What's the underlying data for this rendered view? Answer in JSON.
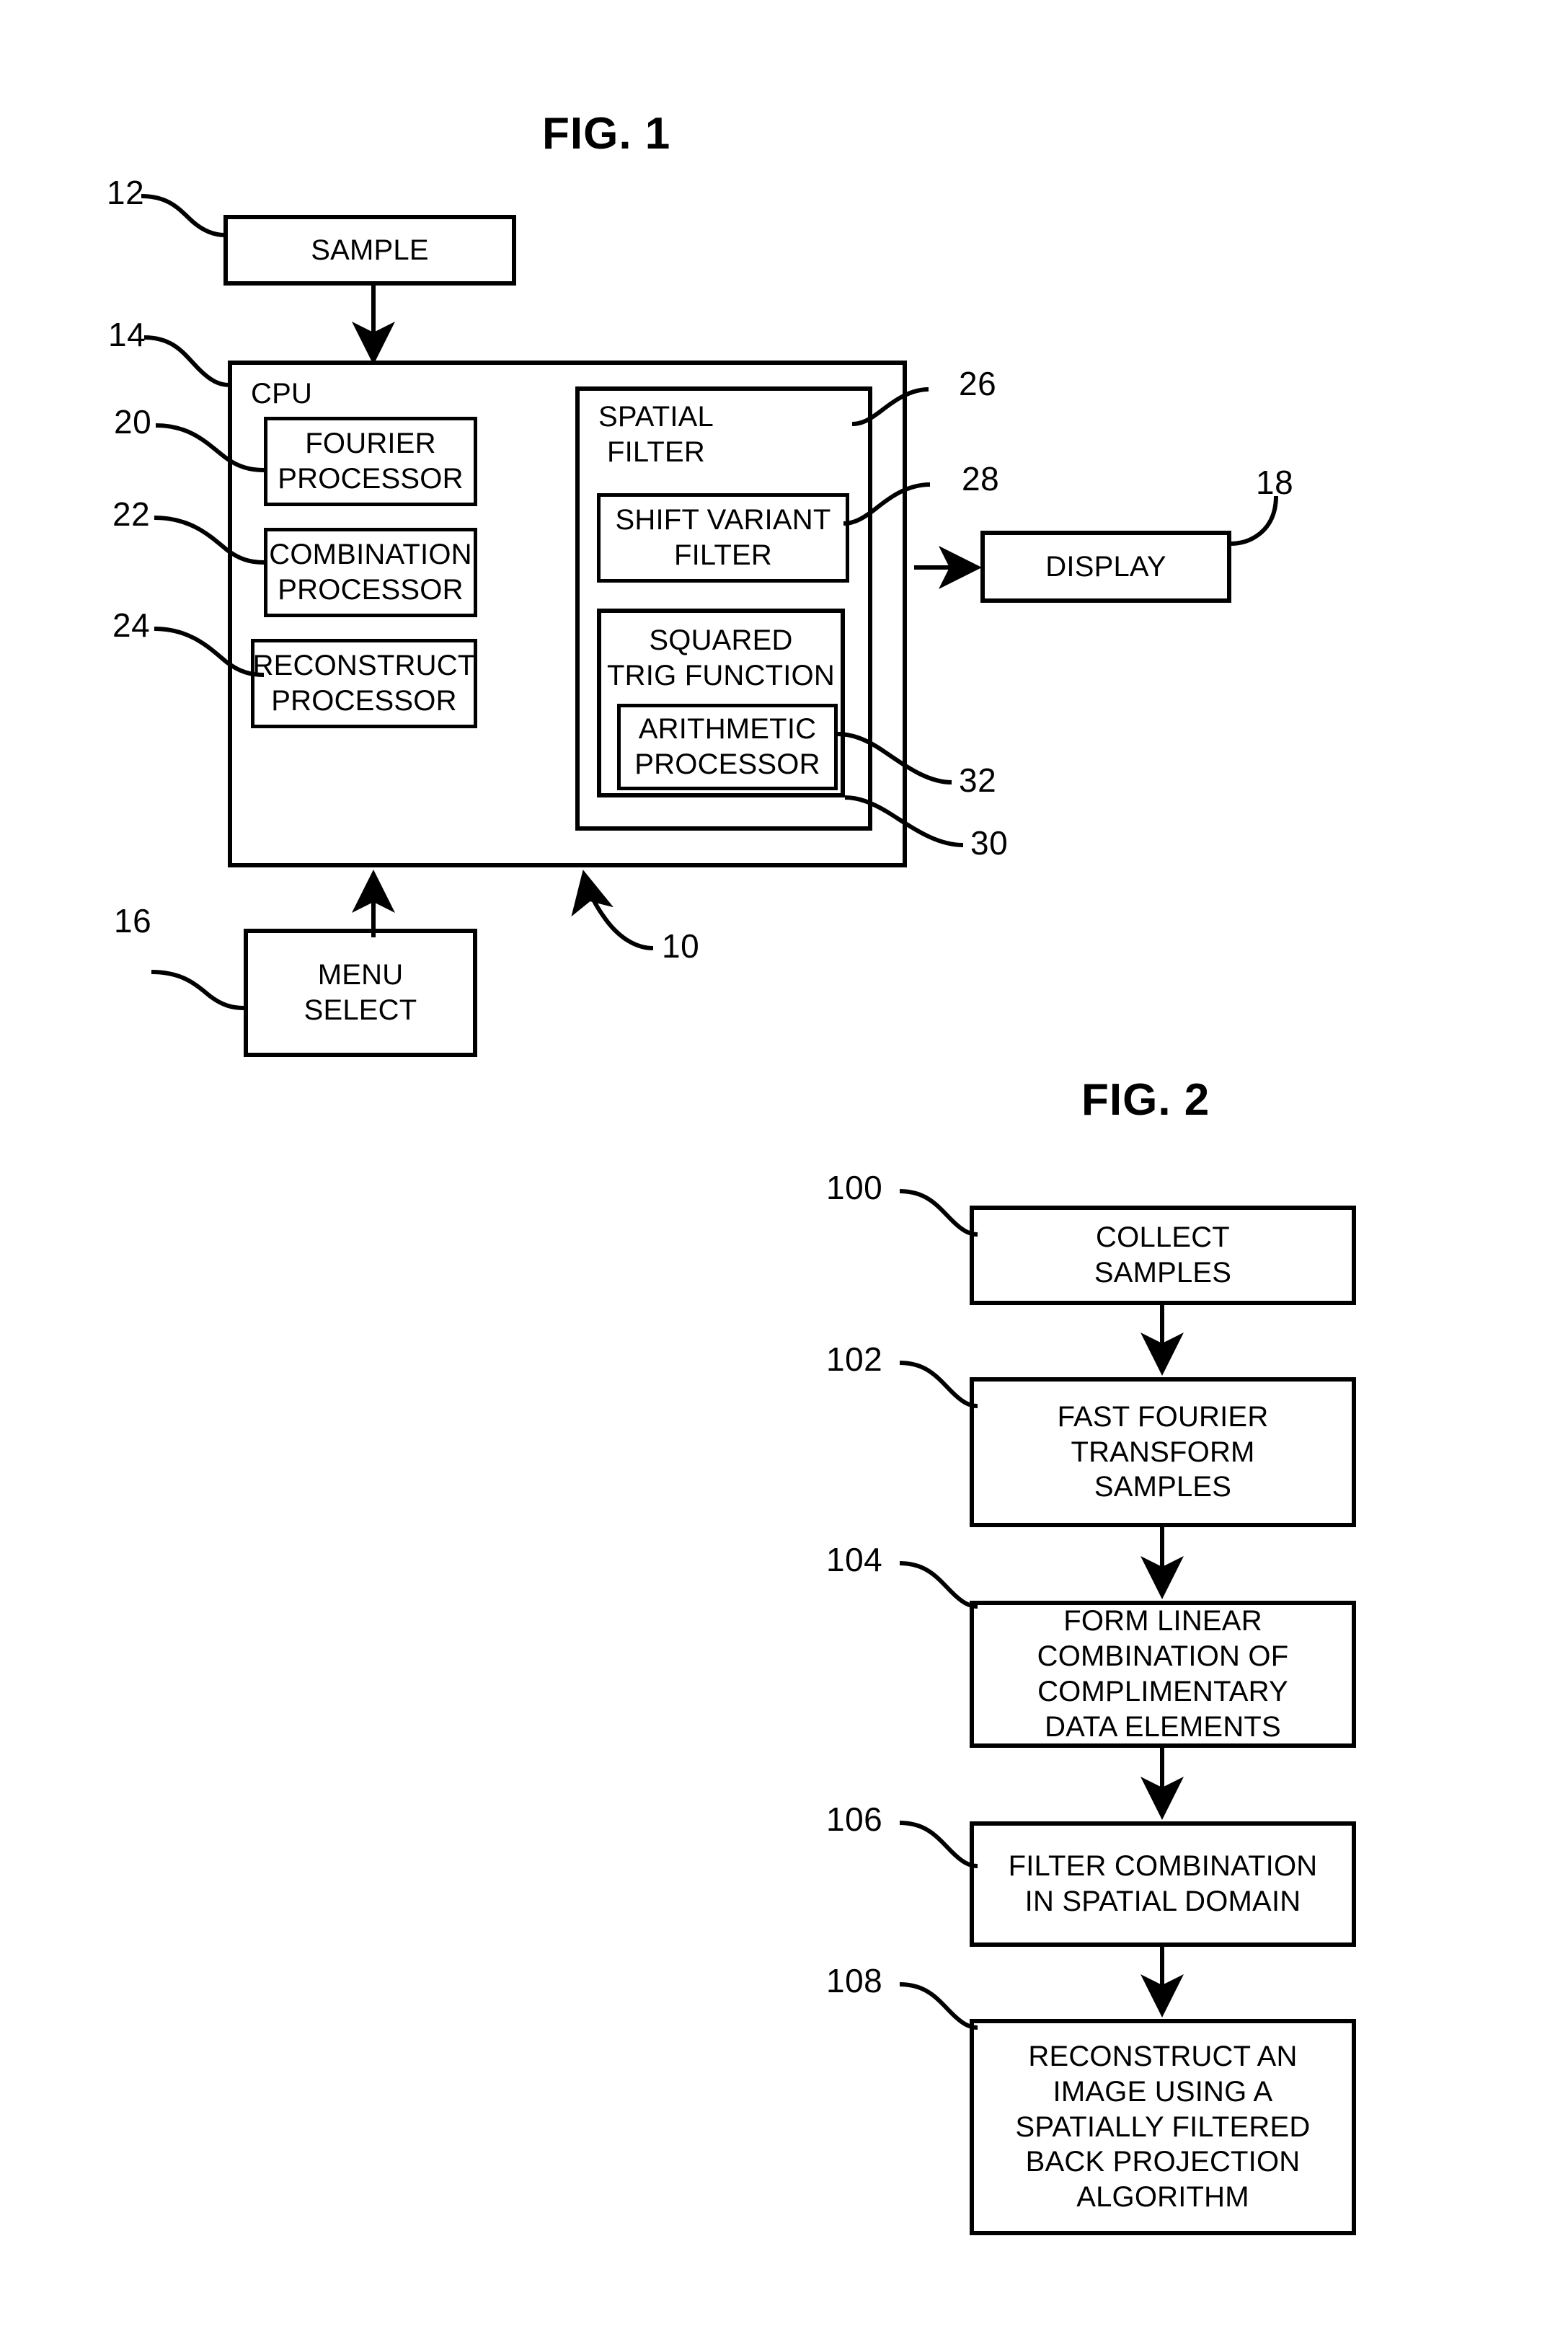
{
  "figures": [
    {
      "id": "fig1",
      "title": "FIG. 1",
      "blocks": {
        "sample": "SAMPLE",
        "cpu": "CPU",
        "fourier_processor": "FOURIER\nPROCESSOR",
        "combination_processor": "COMBINATION\nPROCESSOR",
        "reconstruct_processor": "RECONSTRUCT\nPROCESSOR",
        "spatial_filter": "SPATIAL\nFILTER",
        "shift_variant_filter": "SHIFT VARIANT\nFILTER",
        "squared_trig_function": "SQUARED\nTRIG FUNCTION",
        "arithmetic_processor": "ARITHMETIC\nPROCESSOR",
        "display": "DISPLAY",
        "menu_select": "MENU\nSELECT"
      },
      "reference_numerals": {
        "sample": "12",
        "cpu": "14",
        "menu_select": "16",
        "display": "18",
        "fourier_processor": "20",
        "combination_processor": "22",
        "reconstruct_processor": "24",
        "spatial_filter": "26",
        "shift_variant_filter": "28",
        "squared_trig_function": "30",
        "arithmetic_processor": "32",
        "system": "10"
      }
    },
    {
      "id": "fig2",
      "title": "FIG. 2",
      "steps": [
        {
          "ref": "100",
          "label": "COLLECT\nSAMPLES"
        },
        {
          "ref": "102",
          "label": "FAST FOURIER\nTRANSFORM\nSAMPLES"
        },
        {
          "ref": "104",
          "label": "FORM LINEAR\nCOMBINATION OF\nCOMPLIMENTARY\nDATA ELEMENTS"
        },
        {
          "ref": "106",
          "label": "FILTER COMBINATION\nIN SPATIAL DOMAIN"
        },
        {
          "ref": "108",
          "label": "RECONSTRUCT AN\nIMAGE USING A\nSPATIALLY FILTERED\nBACK PROJECTION\nALGORITHM"
        }
      ]
    }
  ],
  "colors": {
    "ink": "#000000",
    "paper": "#ffffff"
  }
}
